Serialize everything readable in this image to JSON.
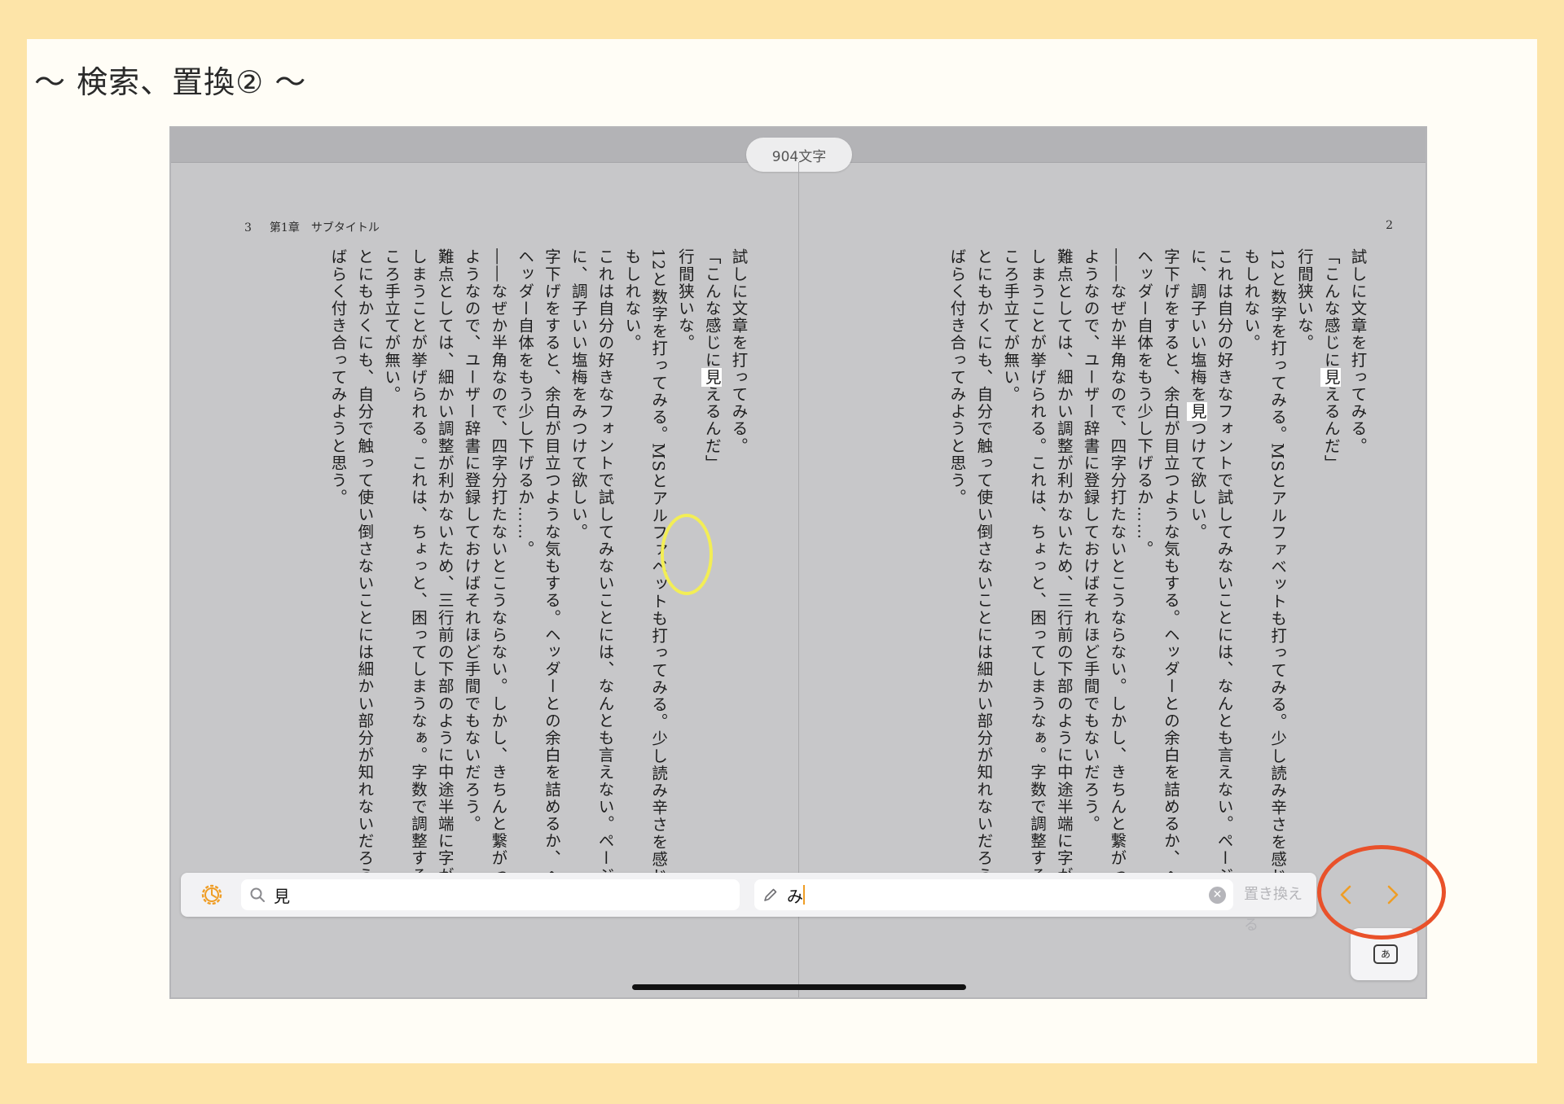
{
  "slide": {
    "title": "〜 検索、置換② 〜"
  },
  "status": {
    "char_count": "904文字"
  },
  "left_page": {
    "page_number": "3",
    "chapter": "第1章　サブタイトル",
    "lines": [
      "試しに文章を打ってみる。",
      "「こんな感じに見えるんだ」",
      "行間狭いな。",
      "12と数字を打ってみる。MSとアルファベットも打ってみる。少し読み辛さを感じる",
      "もしれない。",
      "これは自分の好きなフォントで試してみないことには、なんとも言えない。ページ",
      "に、調子いい塩梅をみつけて欲しい。",
      "字下げをすると、余白が目立つような気もする。ヘッダーとの余白を詰めるか、ヘッダーは",
      "ヘッダー自体をもう少し下げるか……。",
      "――なぜか半角なので、四字分打たないとこうならない。しかし、きちんと繋がってくれる",
      "ようなので、ユーザー辞書に登録しておけばそれほど手間でもないだろう。",
      "難点としては、細かい調整が利かないため、三行前の下部のように中途半端に字が離れて",
      "しまうことが挙げられる。これは、ちょっと、困ってしまうなぁ。字数で調整するのと",
      "ころ手立てが無い。",
      "とにもかくにも、自分で触って使い倒さないことには細かい部分が知れないだろう、し",
      "ばらく付き合ってみようと思う。"
    ]
  },
  "right_page": {
    "page_number": "2",
    "lines": [
      "試しに文章を打ってみる。",
      "「こんな感じに見えるんだ」",
      "行間狭いな。",
      "12と数字を打ってみる。MSとアルファベットも打ってみる。少し読み辛さを感じる",
      "もしれない。",
      "これは自分の好きなフォントで試してみないことには、なんとも言えない。ページ",
      "に、調子いい塩梅を見つけて欲しい。",
      "字下げをすると、余白が目立つような気もする。ヘッダーとの余白を詰めるか、ヘッダーは",
      "ヘッダー自体をもう少し下げるか……。",
      "――なぜか半角なので、四字分打たないとこうならない。しかし、きちんと繋がってくれる",
      "ようなので、ユーザー辞書に登録しておけばそれほど手間でもないだろう。",
      "難点としては、細かい調整が利かないため、三行前の下部のように中途半端に字が離れて",
      "しまうことが挙げられる。これは、ちょっと、困ってしまうなぁ。字数で調整するのと",
      "ころ手立てが無い。",
      "とにもかくにも、自分で触って使い倒さないことには細かい部分が知れないだろう、し",
      "ばらく付き合ってみようと思う。"
    ]
  },
  "find_bar": {
    "search_value": "見",
    "replace_value": "み",
    "replace_label": "置き換える",
    "keyboard_label": "あ"
  },
  "colors": {
    "accent": "#ef9d25",
    "annotation_red": "#e9512a",
    "annotation_yellow": "#f3ee55"
  },
  "icons": [
    "gear-icon",
    "search-icon",
    "pencil-icon",
    "clear-icon",
    "chevron-left-icon",
    "chevron-right-icon",
    "keyboard-icon"
  ]
}
